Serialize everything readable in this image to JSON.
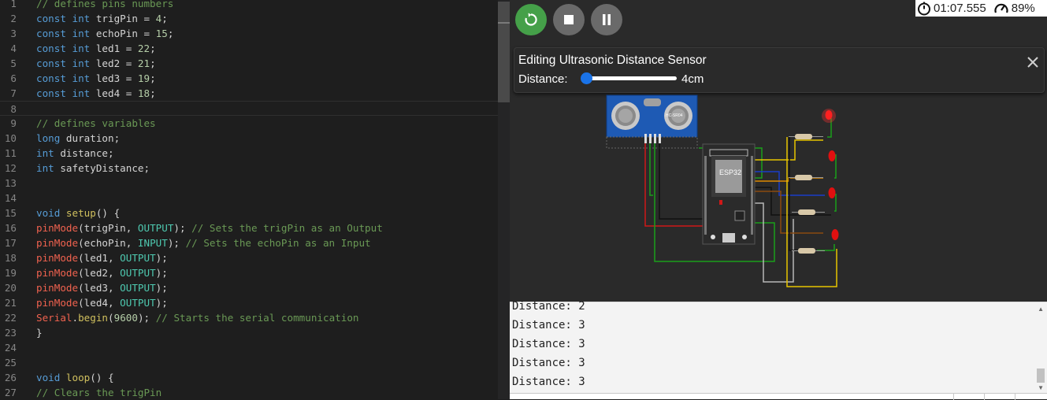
{
  "editor": {
    "lines": [
      {
        "n": "1",
        "tokens": [
          {
            "t": "// defines pins numbers",
            "c": "cm"
          }
        ]
      },
      {
        "n": "2",
        "tokens": [
          {
            "t": "const int ",
            "c": "kw"
          },
          {
            "t": "trigPin = ",
            "c": "id"
          },
          {
            "t": "4",
            "c": "num"
          },
          {
            "t": ";",
            "c": "id"
          }
        ]
      },
      {
        "n": "3",
        "tokens": [
          {
            "t": "const int ",
            "c": "kw"
          },
          {
            "t": "echoPin = ",
            "c": "id"
          },
          {
            "t": "15",
            "c": "num"
          },
          {
            "t": ";",
            "c": "id"
          }
        ]
      },
      {
        "n": "4",
        "tokens": [
          {
            "t": "const int ",
            "c": "kw"
          },
          {
            "t": "led1 = ",
            "c": "id"
          },
          {
            "t": "22",
            "c": "num"
          },
          {
            "t": ";",
            "c": "id"
          }
        ]
      },
      {
        "n": "5",
        "tokens": [
          {
            "t": "const int ",
            "c": "kw"
          },
          {
            "t": "led2 = ",
            "c": "id"
          },
          {
            "t": "21",
            "c": "num"
          },
          {
            "t": ";",
            "c": "id"
          }
        ]
      },
      {
        "n": "6",
        "tokens": [
          {
            "t": "const int ",
            "c": "kw"
          },
          {
            "t": "led3 = ",
            "c": "id"
          },
          {
            "t": "19",
            "c": "num"
          },
          {
            "t": ";",
            "c": "id"
          }
        ]
      },
      {
        "n": "7",
        "tokens": [
          {
            "t": "const int ",
            "c": "kw"
          },
          {
            "t": "led4 = ",
            "c": "id"
          },
          {
            "t": "18",
            "c": "num"
          },
          {
            "t": ";",
            "c": "id"
          }
        ]
      },
      {
        "n": "8",
        "tokens": [],
        "current": true
      },
      {
        "n": "9",
        "tokens": [
          {
            "t": "// defines variables",
            "c": "cm"
          }
        ]
      },
      {
        "n": "10",
        "tokens": [
          {
            "t": "long ",
            "c": "kw"
          },
          {
            "t": "duration;",
            "c": "id"
          }
        ]
      },
      {
        "n": "11",
        "tokens": [
          {
            "t": "int ",
            "c": "kw"
          },
          {
            "t": "distance;",
            "c": "id"
          }
        ]
      },
      {
        "n": "12",
        "tokens": [
          {
            "t": "int ",
            "c": "kw"
          },
          {
            "t": "safetyDistance;",
            "c": "id"
          }
        ]
      },
      {
        "n": "13",
        "tokens": []
      },
      {
        "n": "14",
        "tokens": []
      },
      {
        "n": "15",
        "tokens": [
          {
            "t": "void ",
            "c": "kw"
          },
          {
            "t": "setup",
            "c": "fn2"
          },
          {
            "t": "() {",
            "c": "id"
          }
        ]
      },
      {
        "n": "16",
        "tokens": [
          {
            "t": "pinMode",
            "c": "fn"
          },
          {
            "t": "(trigPin, ",
            "c": "id"
          },
          {
            "t": "OUTPUT",
            "c": "const"
          },
          {
            "t": "); ",
            "c": "id"
          },
          {
            "t": "// Sets the trigPin as an Output",
            "c": "cm"
          }
        ]
      },
      {
        "n": "17",
        "tokens": [
          {
            "t": "pinMode",
            "c": "fn"
          },
          {
            "t": "(echoPin, ",
            "c": "id"
          },
          {
            "t": "INPUT",
            "c": "const"
          },
          {
            "t": "); ",
            "c": "id"
          },
          {
            "t": "// Sets the echoPin as an Input",
            "c": "cm"
          }
        ]
      },
      {
        "n": "18",
        "tokens": [
          {
            "t": "pinMode",
            "c": "fn"
          },
          {
            "t": "(led1, ",
            "c": "id"
          },
          {
            "t": "OUTPUT",
            "c": "const"
          },
          {
            "t": ");",
            "c": "id"
          }
        ]
      },
      {
        "n": "19",
        "tokens": [
          {
            "t": "pinMode",
            "c": "fn"
          },
          {
            "t": "(led2, ",
            "c": "id"
          },
          {
            "t": "OUTPUT",
            "c": "const"
          },
          {
            "t": ");",
            "c": "id"
          }
        ]
      },
      {
        "n": "20",
        "tokens": [
          {
            "t": "pinMode",
            "c": "fn"
          },
          {
            "t": "(led3, ",
            "c": "id"
          },
          {
            "t": "OUTPUT",
            "c": "const"
          },
          {
            "t": ");",
            "c": "id"
          }
        ]
      },
      {
        "n": "21",
        "tokens": [
          {
            "t": "pinMode",
            "c": "fn"
          },
          {
            "t": "(led4, ",
            "c": "id"
          },
          {
            "t": "OUTPUT",
            "c": "const"
          },
          {
            "t": ");",
            "c": "id"
          }
        ]
      },
      {
        "n": "22",
        "tokens": [
          {
            "t": "Serial",
            "c": "fn"
          },
          {
            "t": ".",
            "c": "id"
          },
          {
            "t": "begin",
            "c": "fn2"
          },
          {
            "t": "(",
            "c": "id"
          },
          {
            "t": "9600",
            "c": "num"
          },
          {
            "t": "); ",
            "c": "id"
          },
          {
            "t": "// Starts the serial communication",
            "c": "cm"
          }
        ]
      },
      {
        "n": "23",
        "tokens": [
          {
            "t": "}",
            "c": "id"
          }
        ]
      },
      {
        "n": "24",
        "tokens": []
      },
      {
        "n": "25",
        "tokens": []
      },
      {
        "n": "26",
        "tokens": [
          {
            "t": "void ",
            "c": "kw"
          },
          {
            "t": "loop",
            "c": "fn2"
          },
          {
            "t": "() {",
            "c": "id"
          }
        ]
      },
      {
        "n": "27",
        "tokens": [
          {
            "t": "// Clears the trigPin",
            "c": "cm"
          }
        ]
      }
    ]
  },
  "toolbar": {
    "restart_icon": "restart-icon",
    "stop_icon": "stop-icon",
    "pause_icon": "pause-icon",
    "timer": "01:07.555",
    "performance": "89%"
  },
  "part_editor": {
    "title": "Editing Ultrasonic Distance Sensor",
    "distance_label": "Distance:",
    "distance_value": "4cm",
    "distance_fraction": 0.01
  },
  "circuit": {
    "sensor_label": "HC-SR04",
    "board_label": "ESP32",
    "led_states": [
      "on",
      "off",
      "off",
      "off"
    ],
    "colors": {
      "wire_green": "#1aa01a",
      "wire_red": "#d01818",
      "wire_black": "#111111",
      "wire_yellow": "#e8c400",
      "wire_orange": "#e08a00",
      "wire_blue": "#1a3cc8",
      "wire_brown": "#8a4a10",
      "wire_gray": "#b8b8b8",
      "led_red": "#e01010",
      "board": "#2b2b2b"
    }
  },
  "serial": {
    "lines": [
      "Distance: 2",
      "Distance: 3",
      "Distance: 3",
      "Distance: 3",
      "Distance: 3"
    ]
  }
}
